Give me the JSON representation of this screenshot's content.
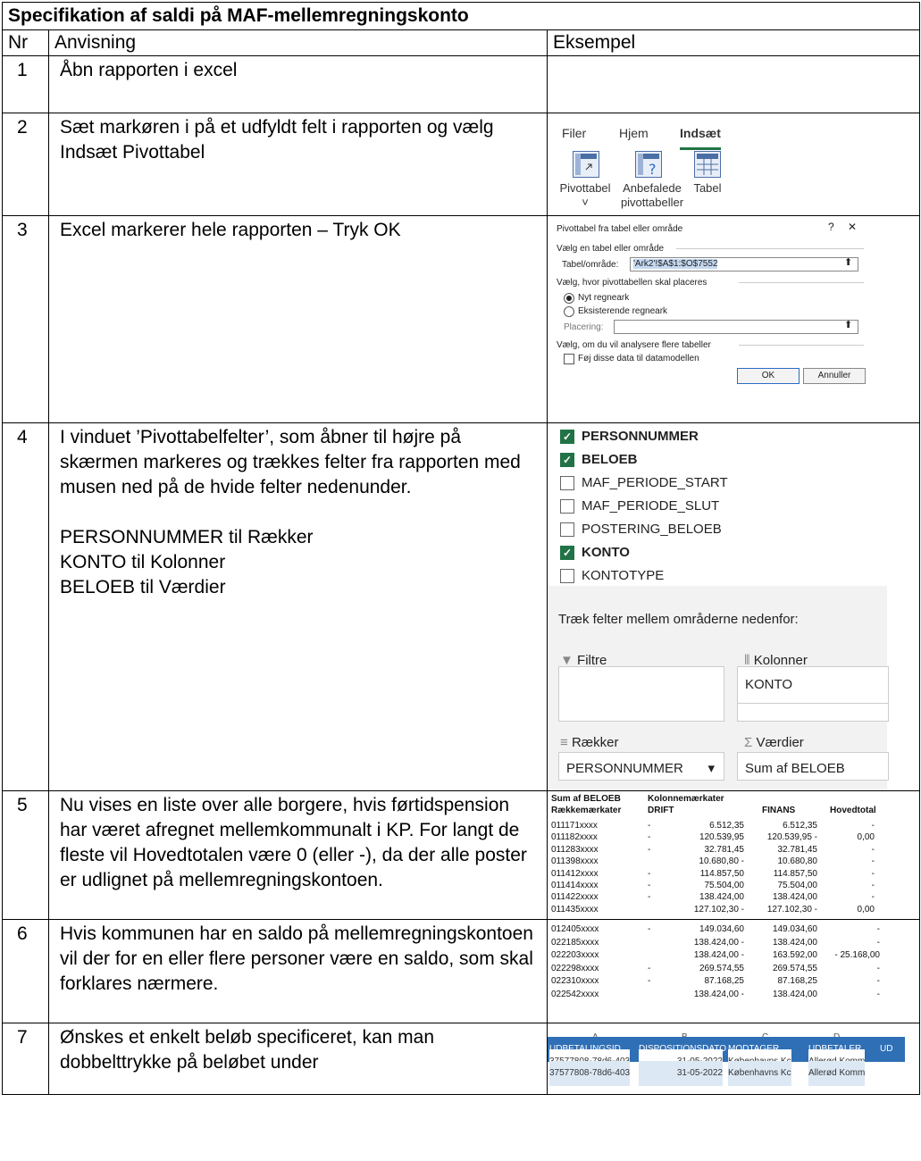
{
  "title": "Specifikation af saldi på MAF-mellemregningskonto",
  "headers": {
    "nr": "Nr",
    "instruction": "Anvisning",
    "example": "Eksempel"
  },
  "rows": [
    {
      "nr": "1",
      "text": "Åbn rapporten i excel"
    },
    {
      "nr": "2",
      "text": "Sæt markøren i på et udfyldt felt i rapporten og vælg Indsæt Pivottabel"
    },
    {
      "nr": "3",
      "text": "Excel markerer hele rapporten – Tryk OK"
    },
    {
      "nr": "4",
      "text": "I vinduet ’Pivottabelfelter’, som åbner til højre på skærmen markeres og trækkes felter fra rapporten med musen ned på de hvide felter nedenunder.",
      "extra": [
        "PERSONNUMMER til Rækker",
        "KONTO til Kolonner",
        "BELOEB til Værdier"
      ]
    },
    {
      "nr": "5",
      "text": "Nu vises en liste over alle borgere, hvis førtidspension har været afregnet mellemkommunalt i KP. For langt de fleste vil Hovedtotalen være 0 (eller -), da der alle poster er udlignet på mellemregningskontoen."
    },
    {
      "nr": "6",
      "text": "Hvis kommunen har en saldo på mellemregningskontoen vil der for en eller flere personer være en saldo, som skal forklares nærmere."
    },
    {
      "nr": "7",
      "text": "Ønskes et enkelt beløb specificeret, kan man dobbelttrykke på beløbet under"
    }
  ],
  "ribbon": {
    "tabs": [
      "Filer",
      "Hjem",
      "Indsæt"
    ],
    "buttons": [
      {
        "label": "Pivottabel\n˅",
        "icon": "pivottable-icon"
      },
      {
        "label": "Anbefalede\npivottabeller",
        "icon": "recommended-pivot-icon"
      },
      {
        "label": "Tabel",
        "icon": "table-icon"
      }
    ]
  },
  "dialog": {
    "title": "Pivottabel fra tabel eller område",
    "help": "?",
    "close": "✕",
    "section1": "Vælg en tabel eller område",
    "range_label": "Tabel/område:",
    "range_value": "'Ark2'!$A$1:$O$7552",
    "section2": "Vælg, hvor pivottabellen skal placeres",
    "opt_new": "Nyt regneark",
    "opt_existing": "Eksisterende regneark",
    "placement_label": "Placering:",
    "section3": "Vælg, om du vil analysere flere tabeller",
    "datamodel": "Føj disse data til datamodellen",
    "ok": "OK",
    "cancel": "Annuller"
  },
  "fields_panel": {
    "fields": [
      {
        "name": "PERSONNUMMER",
        "checked": true
      },
      {
        "name": "BELOEB",
        "checked": true
      },
      {
        "name": "MAF_PERIODE_START",
        "checked": false
      },
      {
        "name": "MAF_PERIODE_SLUT",
        "checked": false
      },
      {
        "name": "POSTERING_BELOEB",
        "checked": false
      },
      {
        "name": "KONTO",
        "checked": true
      },
      {
        "name": "KONTOTYPE",
        "checked": false
      }
    ],
    "drag_hint": "Træk felter mellem områderne nedenfor:",
    "filters": "Filtre",
    "columns": "Kolonner",
    "columns_value": "KONTO",
    "rows": "Rækker",
    "rows_value": "PERSONNUMMER",
    "values": "Værdier",
    "values_value": "Sum af BELOEB"
  },
  "pivot1": {
    "header1": [
      "Sum af BELOEB",
      "Kolonnemærkater"
    ],
    "header2": [
      "Rækkemærkater",
      "DRIFT",
      "FINANS",
      "Hovedtotal"
    ],
    "rows": [
      [
        "011171xxxx",
        "-",
        "6.512,35",
        "6.512,35",
        "-"
      ],
      [
        "011182xxxx",
        "-",
        "120.539,95",
        "120.539,95 -",
        "0,00"
      ],
      [
        "011283xxxx",
        "-",
        "32.781,45",
        "32.781,45",
        "-"
      ],
      [
        "011398xxxx",
        "",
        "10.680,80 -",
        "10.680,80",
        "-"
      ],
      [
        "011412xxxx",
        "-",
        "114.857,50",
        "114.857,50",
        "-"
      ],
      [
        "011414xxxx",
        "-",
        "75.504,00",
        "75.504,00",
        "-"
      ],
      [
        "011422xxxx",
        "-",
        "138.424,00",
        "138.424,00",
        "-"
      ],
      [
        "011435xxxx",
        "",
        "127.102,30 -",
        "127.102,30 -",
        "0,00"
      ]
    ]
  },
  "pivot2": {
    "rows": [
      [
        "012405xxxx",
        "-",
        "149.034,60",
        "149.034,60",
        "-"
      ],
      [
        "022185xxxx",
        "",
        "138.424,00 -",
        "138.424,00",
        "-"
      ],
      [
        "022203xxxx",
        "",
        "138.424,00 -",
        "163.592,00",
        "- 25.168,00"
      ],
      [
        "022298xxxx",
        "-",
        "269.574,55",
        "269.574,55",
        "-"
      ],
      [
        "022310xxxx",
        "-",
        "87.168,25",
        "87.168,25",
        "-"
      ],
      [
        "022542xxxx",
        "",
        "138.424,00 -",
        "138.424,00",
        "-"
      ]
    ]
  },
  "excel_strip": {
    "cols": [
      "A",
      "B",
      "C",
      "D"
    ],
    "headers": [
      "UDBETALINGSID",
      "DISPOSITIONSDATO",
      "MODTAGER",
      "UDBETALER",
      "UD"
    ],
    "rows": [
      [
        "37577808-78d6-403",
        "31-05-2022",
        "Københavns Kc",
        "Allerød Komm"
      ],
      [
        "37577808-78d6-403",
        "31-05-2022",
        "Københavns Kc",
        "Allerød Komm"
      ]
    ],
    "header_color": "#2f6fb5"
  }
}
